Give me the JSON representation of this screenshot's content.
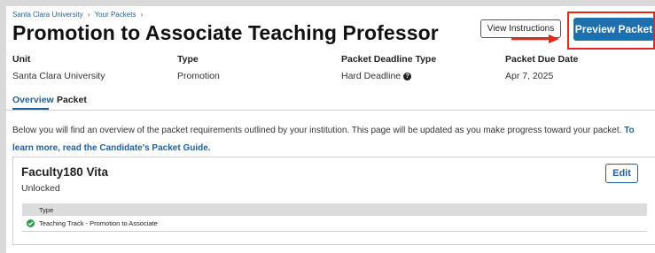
{
  "breadcrumb": {
    "item1": "Santa Clara University",
    "item2": "Your Packets",
    "sep": "›"
  },
  "header": {
    "title": "Promotion to Associate Teaching Professor",
    "view_instructions": "View Instructions",
    "preview_packet": "Preview Packet"
  },
  "meta": {
    "unit_label": "Unit",
    "unit_value": "Santa Clara University",
    "type_label": "Type",
    "type_value": "Promotion",
    "deadline_type_label": "Packet Deadline Type",
    "deadline_type_value": "Hard Deadline",
    "due_date_label": "Packet Due Date",
    "due_date_value": "Apr 7, 2025"
  },
  "tabs": {
    "overview": "Overview",
    "packet": "Packet"
  },
  "intro": {
    "text": "Below you will find an overview of the packet requirements outlined by your institution. This page will be updated as you make progress toward your packet. ",
    "link": "To learn more, read the Candidate's Packet Guide."
  },
  "card": {
    "title": "Faculty180 Vita",
    "status": "Unlocked",
    "edit_label": "Edit",
    "table_header": "Type",
    "rows": [
      {
        "type": "Teaching Track - Promotion to Associate"
      }
    ]
  },
  "colors": {
    "accent": "#1e6fab",
    "highlight": "#e8271c",
    "success": "#2e9e4a"
  },
  "icons": {
    "deadline_help": "question-circle-icon",
    "row_status": "check-circle-icon",
    "annotation": "red-arrow-icon"
  }
}
